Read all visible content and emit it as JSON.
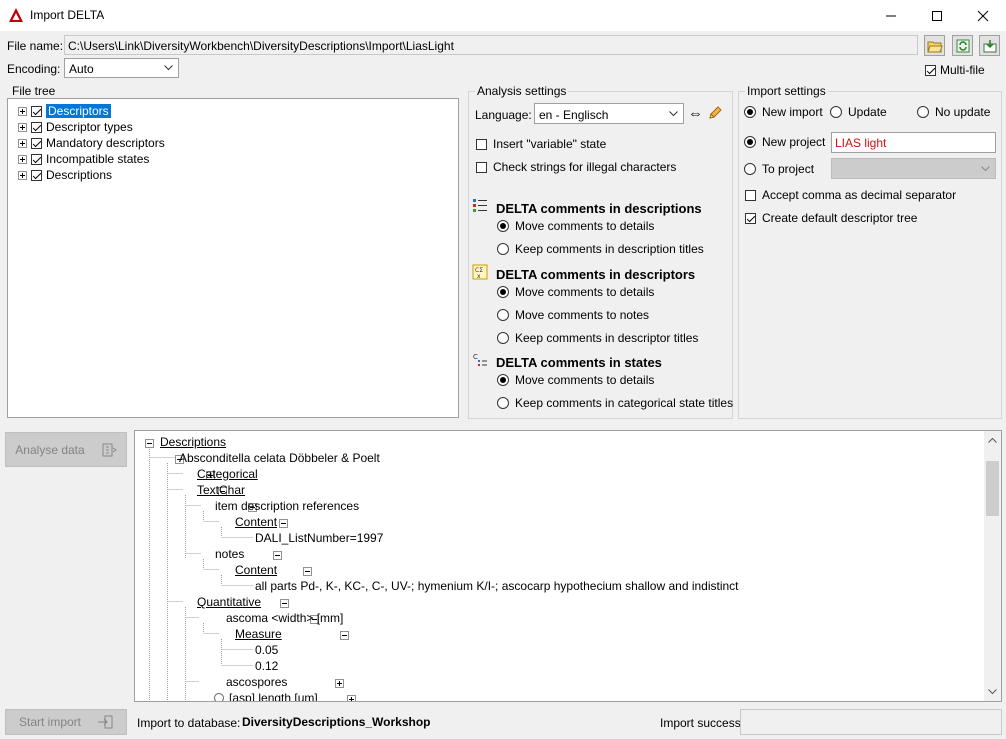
{
  "window": {
    "title": "Import DELTA"
  },
  "file": {
    "label": "File name:",
    "path": "C:\\Users\\Link\\DiversityWorkbench\\DiversityDescriptions\\Import\\LiasLight",
    "encoding_label": "Encoding:",
    "encoding_value": "Auto",
    "multi_file_label": "Multi-file"
  },
  "file_tree": {
    "title": "File tree",
    "items": [
      "Descriptors",
      "Descriptor types",
      "Mandatory descriptors",
      "Incompatible states",
      "Descriptions"
    ]
  },
  "analysis": {
    "title": "Analysis settings",
    "language_label": "Language:",
    "language_value": "en - Englisch",
    "insert_variable": "Insert \"variable\" state",
    "check_strings": "Check strings for illegal characters",
    "desc_comments": {
      "title": "DELTA comments in descriptions",
      "opt1": "Move comments to details",
      "opt2": "Keep comments in description titles"
    },
    "descriptor_comments": {
      "title": "DELTA comments in descriptors",
      "opt1": "Move comments to details",
      "opt2": "Move comments to notes",
      "opt3": "Keep comments in descriptor titles"
    },
    "state_comments": {
      "title": "DELTA comments in states",
      "opt1": "Move comments to details",
      "opt2": "Keep comments in categorical state titles"
    }
  },
  "import": {
    "title": "Import settings",
    "new_import": "New import",
    "update": "Update",
    "no_update": "No update",
    "new_project_label": "New project",
    "new_project_value": "LIAS light",
    "to_project_label": "To project",
    "accept_comma": "Accept comma as decimal separator",
    "create_tree": "Create default descriptor tree"
  },
  "buttons": {
    "analyse": "Analyse data",
    "start_import": "Start import"
  },
  "xml": {
    "descriptions": "Descriptions",
    "taxon": "Absconditella celata Döbbeler & Poelt",
    "categorical": "Categorical",
    "textchar": "TextChar",
    "item_refs": "item description references",
    "content1": "Content",
    "dali": "DALI_ListNumber=1997",
    "notes": "notes",
    "content2": "Content",
    "notes_text": "all parts Pd-, K-, KC-, C-, UV-; hymenium K/I-; ascocarp hypothecium shallow and indistinct",
    "quantitative": "Quantitative",
    "ascoma": "ascoma <width> [mm]",
    "measure": "Measure",
    "v1": "0.05",
    "v2": "0.12",
    "ascospores": "ascospores",
    "asp_length": "[asp] length [um]"
  },
  "footer": {
    "db_label": "Import to database:",
    "db_value": "DiversityDescriptions_Workshop",
    "success_label": "Import success"
  }
}
